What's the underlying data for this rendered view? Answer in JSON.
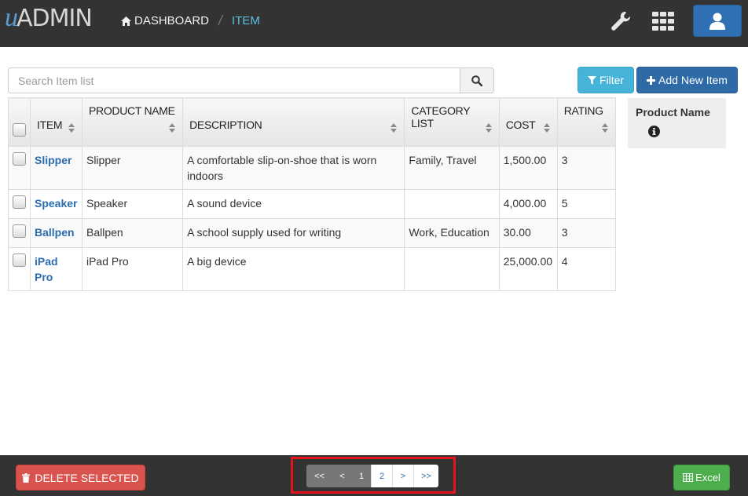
{
  "header": {
    "logo_u": "u",
    "logo_text": "ADMIN",
    "breadcrumb": {
      "home_label": "DASHBOARD",
      "current_label": "ITEM",
      "separator": "/"
    },
    "icons": [
      "wrench-icon",
      "apps-grid-icon",
      "user-icon"
    ]
  },
  "toolbar": {
    "search_placeholder": "Search Item list",
    "filter_label": "Filter",
    "add_label": "Add New Item"
  },
  "table": {
    "columns": [
      "ITEM",
      "PRODUCT NAME",
      "DESCRIPTION",
      "CATEGORY LIST",
      "COST",
      "RATING"
    ],
    "rows": [
      {
        "item": "Slipper",
        "product_name": "Slipper",
        "description": "A comfortable slip-on-shoe that is worn indoors",
        "category_list": "Family, Travel",
        "cost": "1,500.00",
        "rating": "3"
      },
      {
        "item": "Speaker",
        "product_name": "Speaker",
        "description": "A sound device",
        "category_list": "",
        "cost": "4,000.00",
        "rating": "5"
      },
      {
        "item": "Ballpen",
        "product_name": "Ballpen",
        "description": "A school supply used for writing",
        "category_list": "Work, Education",
        "cost": "30.00",
        "rating": "3"
      },
      {
        "item": "iPad Pro",
        "product_name": "iPad Pro",
        "description": "A big device",
        "category_list": "",
        "cost": "25,000.00",
        "rating": "4"
      }
    ]
  },
  "side_panel": {
    "title": "Product Name"
  },
  "footer": {
    "delete_label": "DELETE SELECTED",
    "excel_label": "Excel",
    "pagination": {
      "first": "<<",
      "prev": "<",
      "pages": [
        "1",
        "2"
      ],
      "current_page": "1",
      "next": ">",
      "last": ">>"
    }
  },
  "colors": {
    "topbar": "#333333",
    "accent_blue": "#2d6aa6",
    "info": "#46b3d8",
    "danger": "#d9534f",
    "success": "#4cae4c",
    "highlight_frame": "#e3141b"
  }
}
